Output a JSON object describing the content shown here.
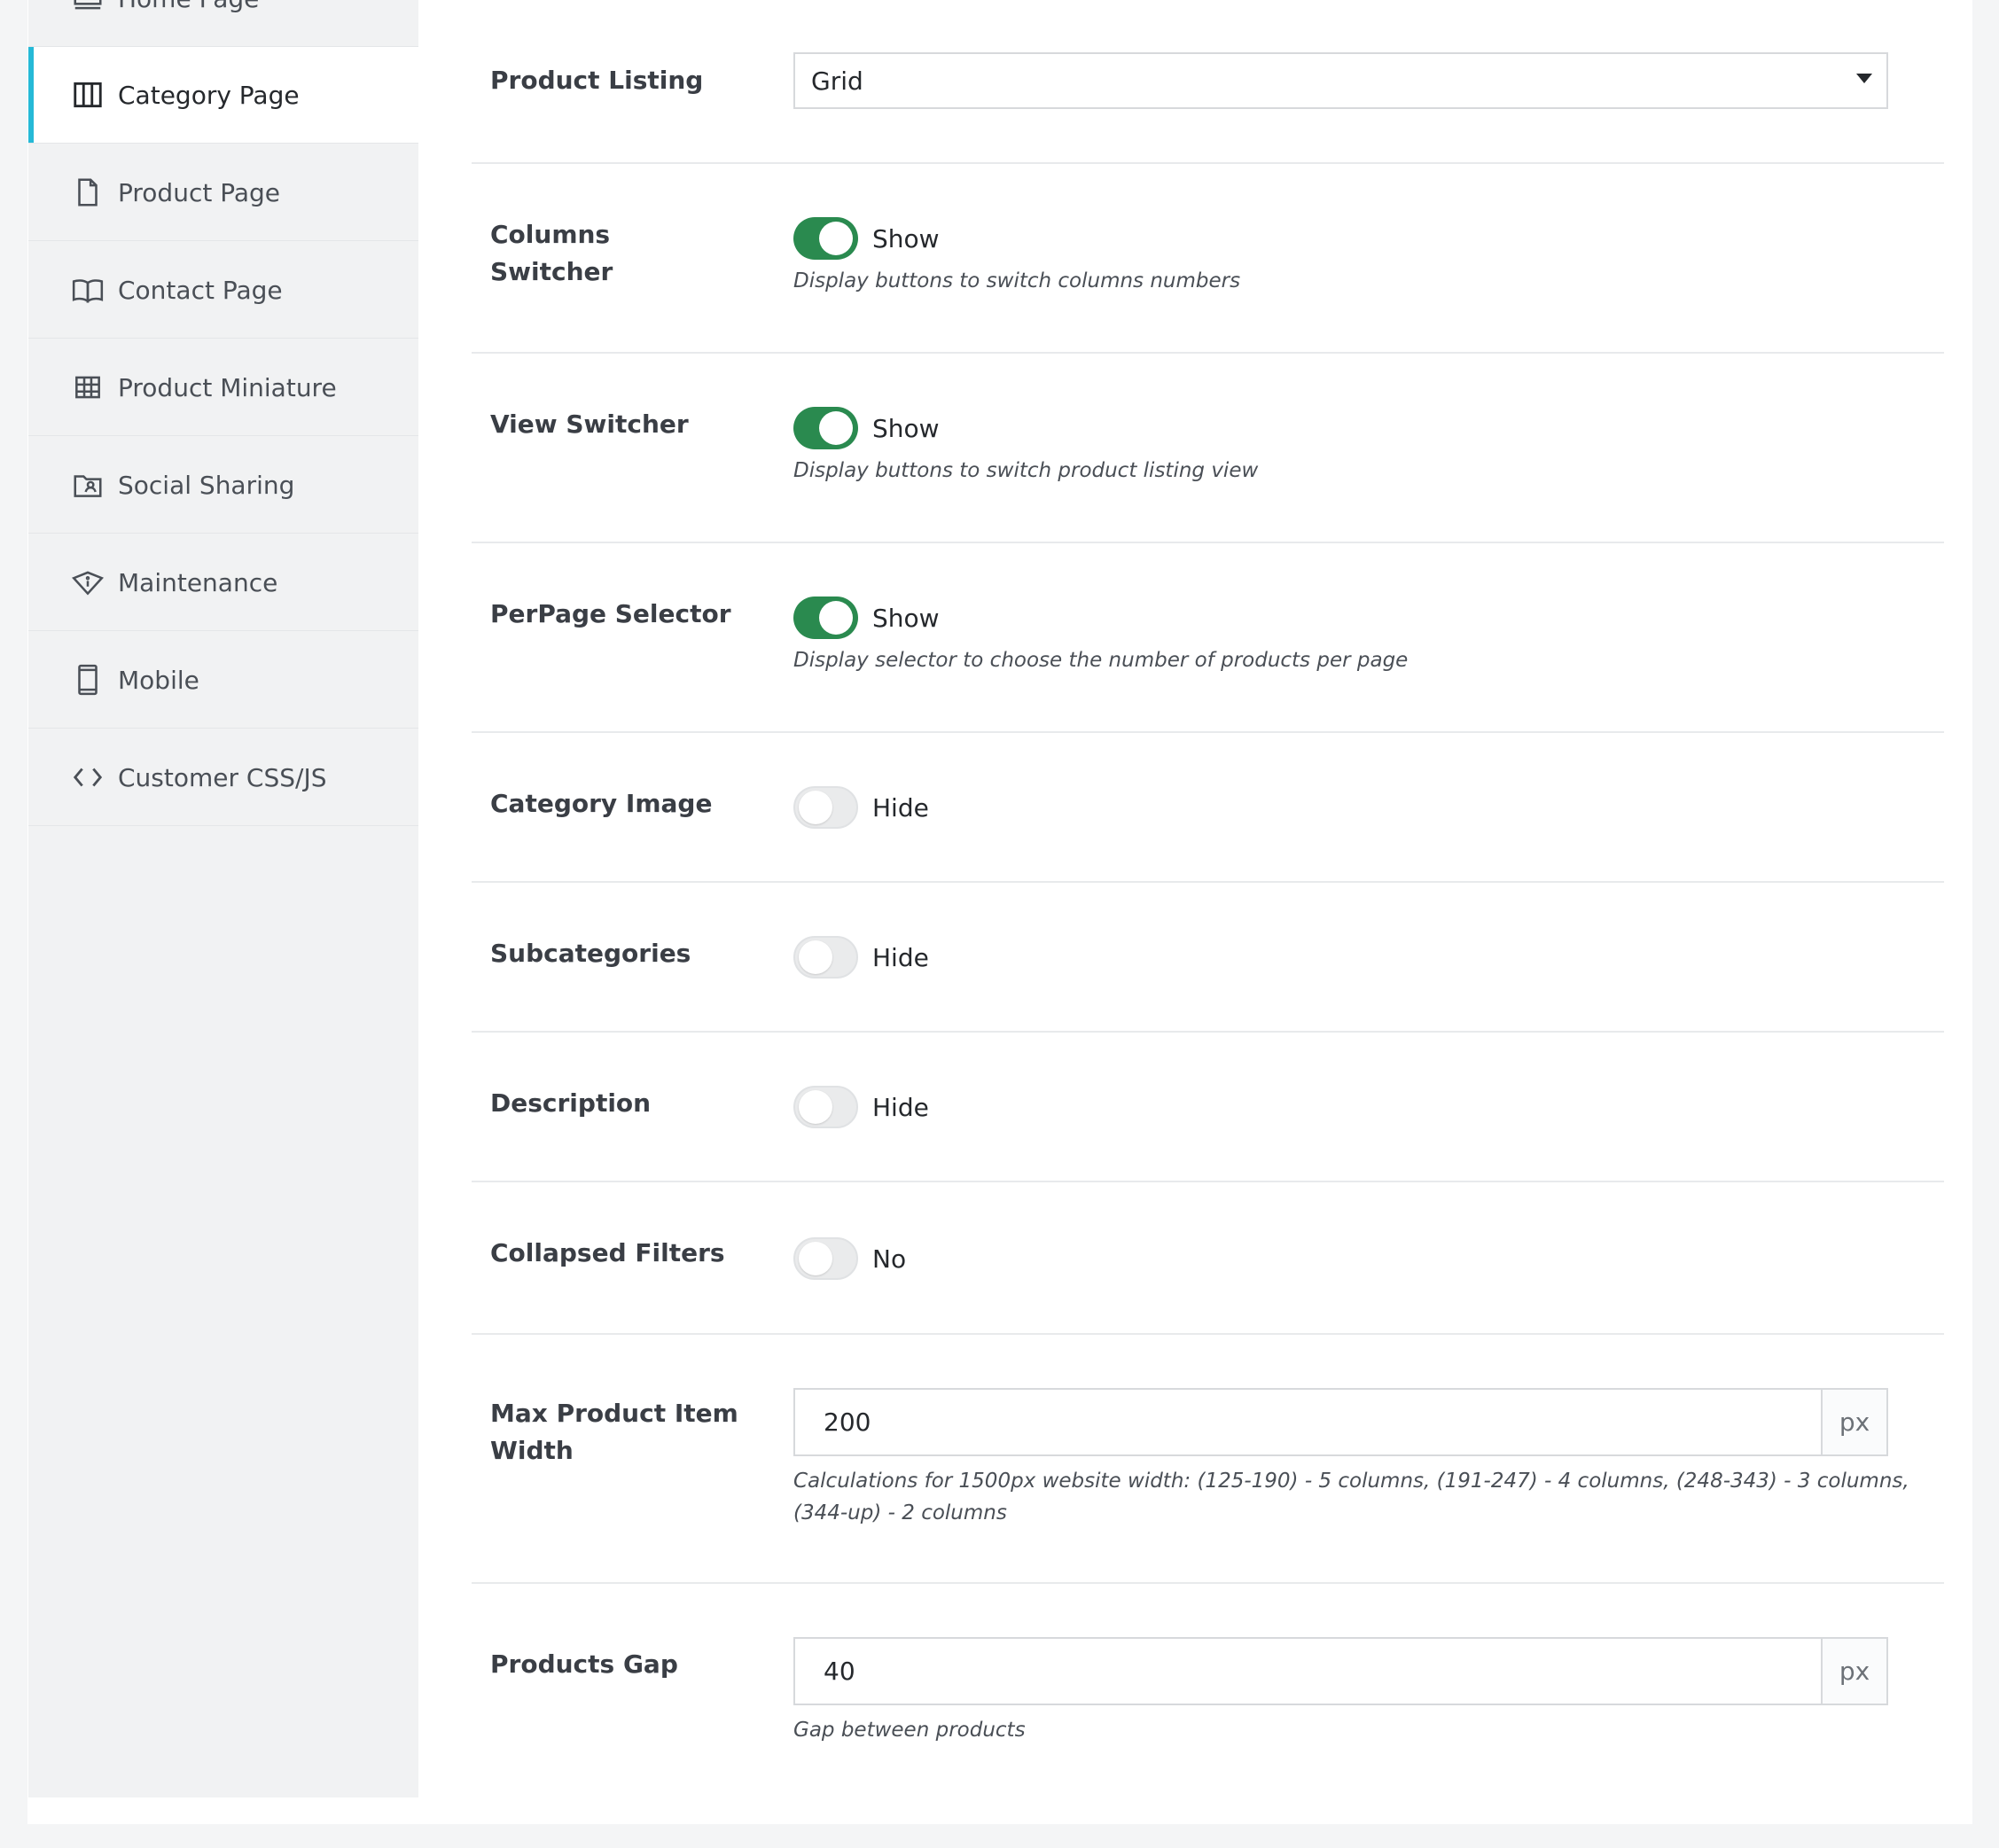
{
  "sidebar": {
    "items": [
      {
        "label": "Home Page",
        "icon": "monitor-icon"
      },
      {
        "label": "Category Page",
        "icon": "columns-icon",
        "active": true
      },
      {
        "label": "Product Page",
        "icon": "file-icon"
      },
      {
        "label": "Contact Page",
        "icon": "book-icon"
      },
      {
        "label": "Product Miniature",
        "icon": "grid-icon"
      },
      {
        "label": "Social Sharing",
        "icon": "folder-user-icon"
      },
      {
        "label": "Maintenance",
        "icon": "diamond-icon"
      },
      {
        "label": "Mobile",
        "icon": "mobile-icon"
      },
      {
        "label": "Customer CSS/JS",
        "icon": "code-icon"
      }
    ]
  },
  "form": {
    "product_listing": {
      "label": "Product Listing",
      "value": "Grid"
    },
    "columns_switcher": {
      "label": "Columns Switcher",
      "state": "Show",
      "on": true,
      "help": "Display buttons to switch columns numbers"
    },
    "view_switcher": {
      "label": "View Switcher",
      "state": "Show",
      "on": true,
      "help": "Display buttons to switch product listing view"
    },
    "perpage_selector": {
      "label": "PerPage Selector",
      "state": "Show",
      "on": true,
      "help": "Display selector to choose the number of products per page"
    },
    "category_image": {
      "label": "Category Image",
      "state": "Hide",
      "on": false
    },
    "subcategories": {
      "label": "Subcategories",
      "state": "Hide",
      "on": false
    },
    "description": {
      "label": "Description",
      "state": "Hide",
      "on": false
    },
    "collapsed_filters": {
      "label": "Collapsed Filters",
      "state": "No",
      "on": false
    },
    "max_item_width": {
      "label_line1": "Max Product Item",
      "label_line2": "Width",
      "value": "200",
      "unit": "px",
      "help_line1": "Calculations for 1500px website width: (125-190) - 5 columns, (191-247) - 4 columns, (248-343) - 3 columns,",
      "help_line2": "(344-up) - 2 columns"
    },
    "products_gap": {
      "label": "Products Gap",
      "value": "40",
      "unit": "px",
      "help": "Gap between products"
    }
  },
  "colors": {
    "accent": "#25b9d7",
    "toggle_on": "#2a8a4f"
  }
}
